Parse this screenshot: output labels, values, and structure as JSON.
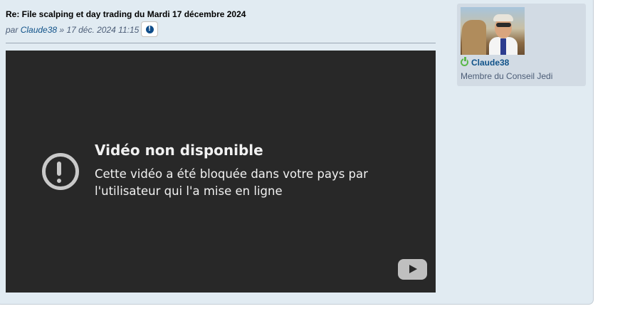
{
  "post": {
    "title": "Re: File scalping et day trading du Mardi 17 décembre 2024",
    "by_prefix": "par",
    "author": "Claude38",
    "date_separator": "»",
    "date": "17 déc. 2024 11:15",
    "info_icon": "info-icon"
  },
  "video": {
    "title": "Vidéo non disponible",
    "message": "Cette vidéo a été bloquée dans votre pays par l'utilisateur qui l'a mise en ligne",
    "alert_icon": "alert-circle-icon",
    "logo_icon": "youtube-logo-icon"
  },
  "profile": {
    "username": "Claude38",
    "rank": "Membre du Conseil Jedi",
    "status_icon": "online-power-icon"
  },
  "colors": {
    "panel_bg": "#e1ebf2",
    "profile_bg": "#d2dbe4",
    "link": "#105289",
    "meta_text": "#4c5d77",
    "video_bg": "#282828",
    "online": "#5bb84a"
  }
}
